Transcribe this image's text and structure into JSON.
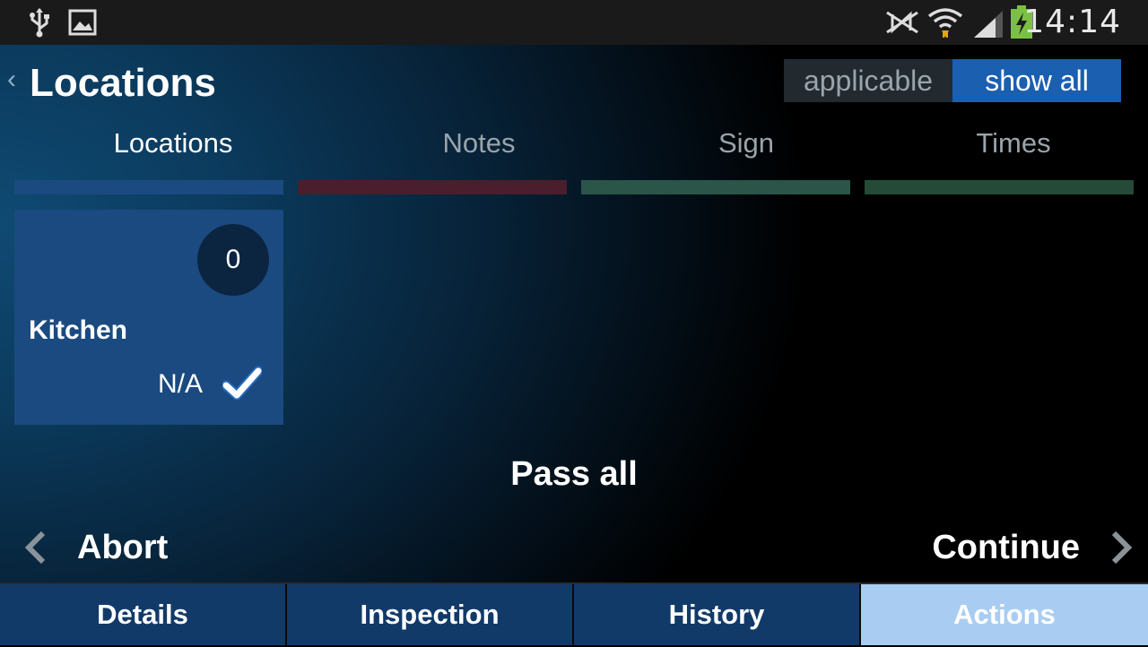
{
  "status_bar": {
    "time": "14:14",
    "icons": [
      "usb-icon",
      "image-icon",
      "nfc-off-icon",
      "wifi-icon",
      "signal-icon",
      "battery-charging-icon"
    ]
  },
  "header": {
    "title": "Locations",
    "filter": {
      "options": [
        "applicable",
        "show all"
      ],
      "selected": "show all"
    }
  },
  "tabs": [
    {
      "label": "Locations",
      "color": "#1a4a80",
      "active": true
    },
    {
      "label": "Notes",
      "color": "#4a1e2c",
      "active": false
    },
    {
      "label": "Sign",
      "color": "#2a5548",
      "active": false
    },
    {
      "label": "Times",
      "color": "#254a38",
      "active": false
    }
  ],
  "locations": [
    {
      "name": "Kitchen",
      "count": "0",
      "status": "N/A",
      "checked": true
    }
  ],
  "actions": {
    "pass_all": "Pass all",
    "abort": "Abort",
    "continue": "Continue"
  },
  "bottom_tabs": [
    {
      "label": "Details"
    },
    {
      "label": "Inspection"
    },
    {
      "label": "History"
    },
    {
      "label": "Actions",
      "active": true
    }
  ],
  "colors": {
    "accent": "#1a5fb0",
    "active_bottom_tab": "#a9cdf2",
    "bottom_tab": "#123a68"
  }
}
